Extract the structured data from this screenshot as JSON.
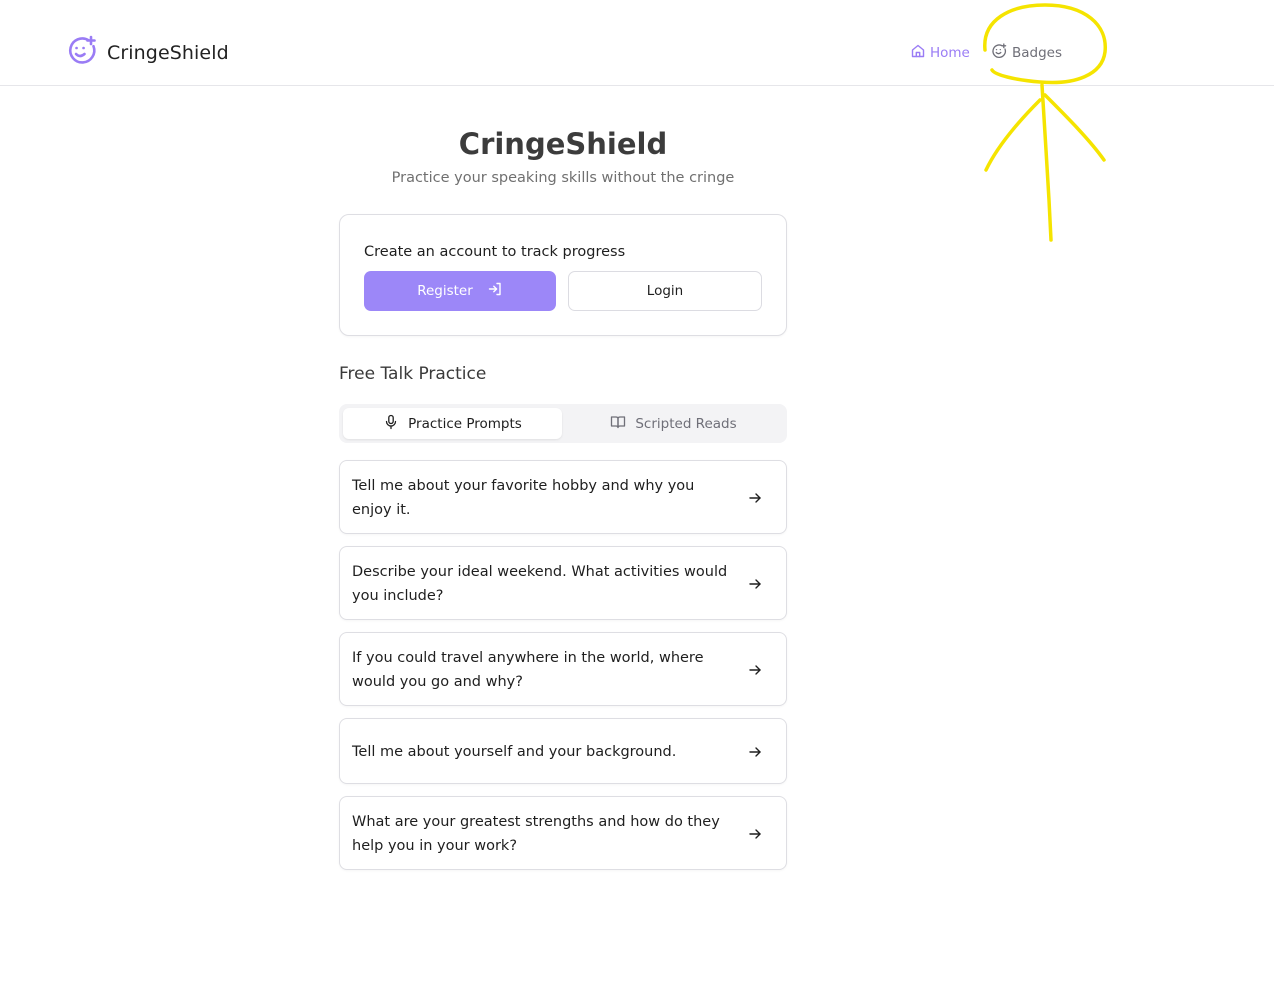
{
  "header": {
    "brand_name": "CringeShield",
    "nav": {
      "home_label": "Home",
      "badges_label": "Badges"
    },
    "accent_color": "#9a7cf5"
  },
  "hero": {
    "title": "CringeShield",
    "subtitle": "Practice your speaking skills without the cringe"
  },
  "account": {
    "message": "Create an account to track progress",
    "register_label": "Register",
    "login_label": "Login"
  },
  "practice": {
    "section_title": "Free Talk Practice",
    "tabs": [
      {
        "label": "Practice Prompts",
        "icon": "microphone-icon",
        "active": true
      },
      {
        "label": "Scripted Reads",
        "icon": "book-open-icon",
        "active": false
      }
    ],
    "prompts": [
      {
        "text": "Tell me about your favorite hobby and why you enjoy it."
      },
      {
        "text": "Describe your ideal weekend. What activities would you include?"
      },
      {
        "text": "If you could travel anywhere in the world, where would you go and why?"
      },
      {
        "text": "Tell me about yourself and your background."
      },
      {
        "text": "What are your greatest strengths and how do they help you in your work?"
      }
    ]
  },
  "annotation_color": "#f5e400"
}
